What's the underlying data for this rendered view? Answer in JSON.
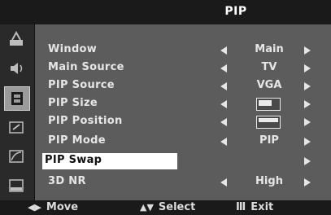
{
  "menu": {
    "title": "PIP"
  },
  "sidebar": {
    "icons": [
      "picture-icon",
      "sound-icon",
      "setup-icon",
      "input-icon",
      "function-icon",
      "pip-icon"
    ],
    "active": 2
  },
  "rows": [
    {
      "label": "Window",
      "value": "Main",
      "has_left": true,
      "has_right": true
    },
    {
      "label": "Main Source",
      "value": "TV",
      "has_left": true,
      "has_right": true
    },
    {
      "label": "PIP Source",
      "value": "VGA",
      "has_left": true,
      "has_right": true
    },
    {
      "label": "PIP Size",
      "value_icon": "pip-size-icon",
      "has_left": true,
      "has_right": true
    },
    {
      "label": "PIP Position",
      "value_icon": "pip-position-icon",
      "has_left": true,
      "has_right": true
    },
    {
      "label": "PIP Mode",
      "value": "PIP",
      "has_left": true,
      "has_right": true
    },
    {
      "label": "PIP Swap",
      "value": "",
      "has_left": false,
      "has_right": true,
      "selected": true
    },
    {
      "label": "3D NR",
      "value": "High",
      "has_left": true,
      "has_right": true
    }
  ],
  "footer": {
    "move_label": "Move",
    "select_label": "Select",
    "exit_label": "Exit"
  }
}
